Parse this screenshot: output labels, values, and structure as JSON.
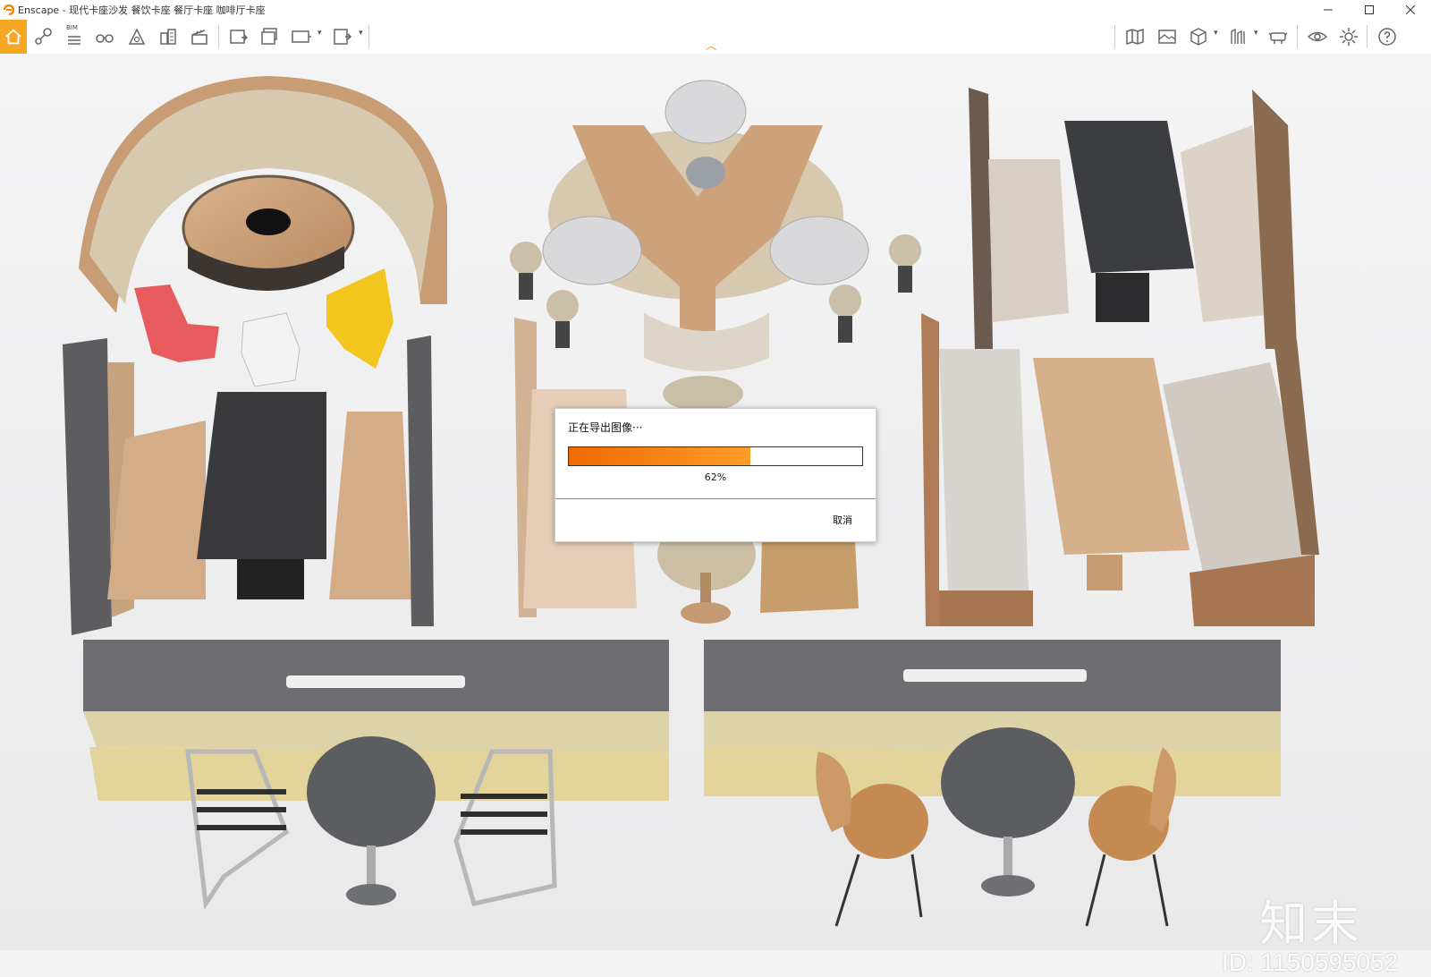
{
  "window": {
    "app_name": "Enscape",
    "title": "Enscape - 现代卡座沙发 餐饮卡座 餐厅卡座 咖啡厅卡座",
    "controls": [
      "minimize-icon",
      "maximize-icon",
      "close-icon"
    ]
  },
  "toolbar": {
    "bim_label": "BIM",
    "left_tools": [
      "home-icon",
      "path-icon",
      "bim-icon",
      "binoculars-icon",
      "asset-library-icon",
      "buildings-icon",
      "clapper-icon",
      "screenshot-export-icon",
      "batch-export-icon",
      "panorama-export-icon",
      "exe-export-icon"
    ],
    "right_tools": [
      "map-icon",
      "gallery-icon",
      "cube-icon",
      "vr-icon",
      "headset-icon",
      "view-eye-icon",
      "settings-gear-icon",
      "help-icon"
    ],
    "accent_color": "#f5a623"
  },
  "dialog": {
    "title": "正在导出图像···",
    "progress_fraction": 0.62,
    "progress_text": "62%",
    "cancel_label": "取消",
    "bar_color": "#f07800"
  },
  "watermark": {
    "brand": "知末",
    "id_text": "ID: 1150595052"
  }
}
